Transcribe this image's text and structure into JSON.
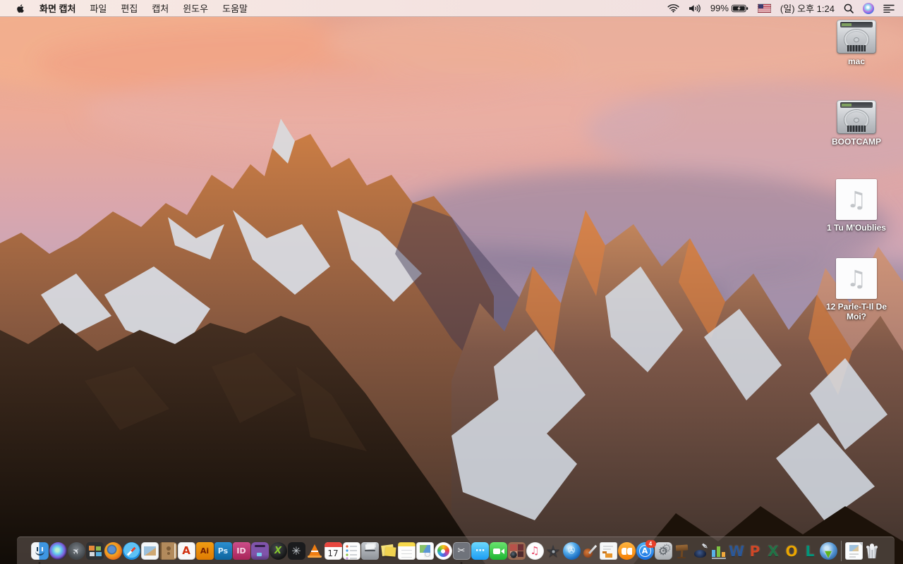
{
  "menu_bar": {
    "app_name": "화면 캡처",
    "menus": [
      "파일",
      "편집",
      "캡처",
      "윈도우",
      "도움말"
    ],
    "status": {
      "battery_percent": "99%",
      "battery_charging": true,
      "flag": "us-flag",
      "clock": "(일) 오후 1:24"
    },
    "right_icons": [
      "wifi-icon",
      "volume-icon",
      "battery-icon",
      "flag-icon",
      "spotlight-icon",
      "siri-icon",
      "notification-center-icon"
    ]
  },
  "desktop": {
    "icons": [
      {
        "label": "mac",
        "type": "hard-drive"
      },
      {
        "label": "BOOTCAMP",
        "type": "hard-drive"
      },
      {
        "label": "1 Tu M'Oublies",
        "type": "audio-file"
      },
      {
        "label": "12 Parle-T-Il De Moi?",
        "type": "audio-file"
      }
    ],
    "audio_note_glyph": "♫"
  },
  "dock": {
    "items": [
      {
        "name": "finder",
        "running": true
      },
      {
        "name": "siri"
      },
      {
        "name": "launchpad",
        "glyph": "✈"
      },
      {
        "name": "mission-control"
      },
      {
        "name": "firefox"
      },
      {
        "name": "safari"
      },
      {
        "name": "preview"
      },
      {
        "name": "contacts"
      },
      {
        "name": "acrobat-reader",
        "glyph": "A"
      },
      {
        "name": "illustrator",
        "glyph": "Ai"
      },
      {
        "name": "photoshop",
        "glyph": "Ps"
      },
      {
        "name": "indesign",
        "glyph": "ID"
      },
      {
        "name": "toast"
      },
      {
        "name": "green-x-app",
        "glyph": "X"
      },
      {
        "name": "aperture",
        "glyph": "✳"
      },
      {
        "name": "vlc"
      },
      {
        "name": "calendar",
        "glyph": "17"
      },
      {
        "name": "reminders"
      },
      {
        "name": "mail-drop"
      },
      {
        "name": "stickies"
      },
      {
        "name": "notes"
      },
      {
        "name": "greeting-card"
      },
      {
        "name": "photos"
      },
      {
        "name": "grab",
        "glyph": "✂",
        "running": true
      },
      {
        "name": "messages",
        "glyph": "⋯"
      },
      {
        "name": "facetime"
      },
      {
        "name": "photo-booth"
      },
      {
        "name": "itunes",
        "glyph": "♫"
      },
      {
        "name": "imovie",
        "glyph": "★"
      },
      {
        "name": "dvd-player",
        "glyph": "✇"
      },
      {
        "name": "garageband"
      },
      {
        "name": "unarchiver"
      },
      {
        "name": "ibooks"
      },
      {
        "name": "app-store",
        "glyph": "A",
        "badge": "4"
      },
      {
        "name": "system-preferences",
        "glyph": "⚙"
      },
      {
        "name": "keynote-09"
      },
      {
        "name": "pages-09",
        "glyph": "✒"
      },
      {
        "name": "numbers-09"
      },
      {
        "name": "word",
        "glyph": "W"
      },
      {
        "name": "powerpoint",
        "glyph": "P"
      },
      {
        "name": "excel",
        "glyph": "X"
      },
      {
        "name": "outlook",
        "glyph": "O"
      },
      {
        "name": "lync",
        "glyph": "L"
      },
      {
        "name": "ms-autoupdate",
        "glyph": "▼"
      },
      {
        "name": "dock-separator",
        "type": "separator"
      },
      {
        "name": "document-file"
      },
      {
        "name": "trash"
      }
    ]
  },
  "colors": {
    "menu_bar_tint": "#f5e5e1",
    "dock_tint": "#685c58",
    "badge_red": "#e8402a",
    "app_store_blue": "#1a70e0",
    "sky_top": "#e2a492",
    "sky_mid": "#b8a4c2"
  }
}
